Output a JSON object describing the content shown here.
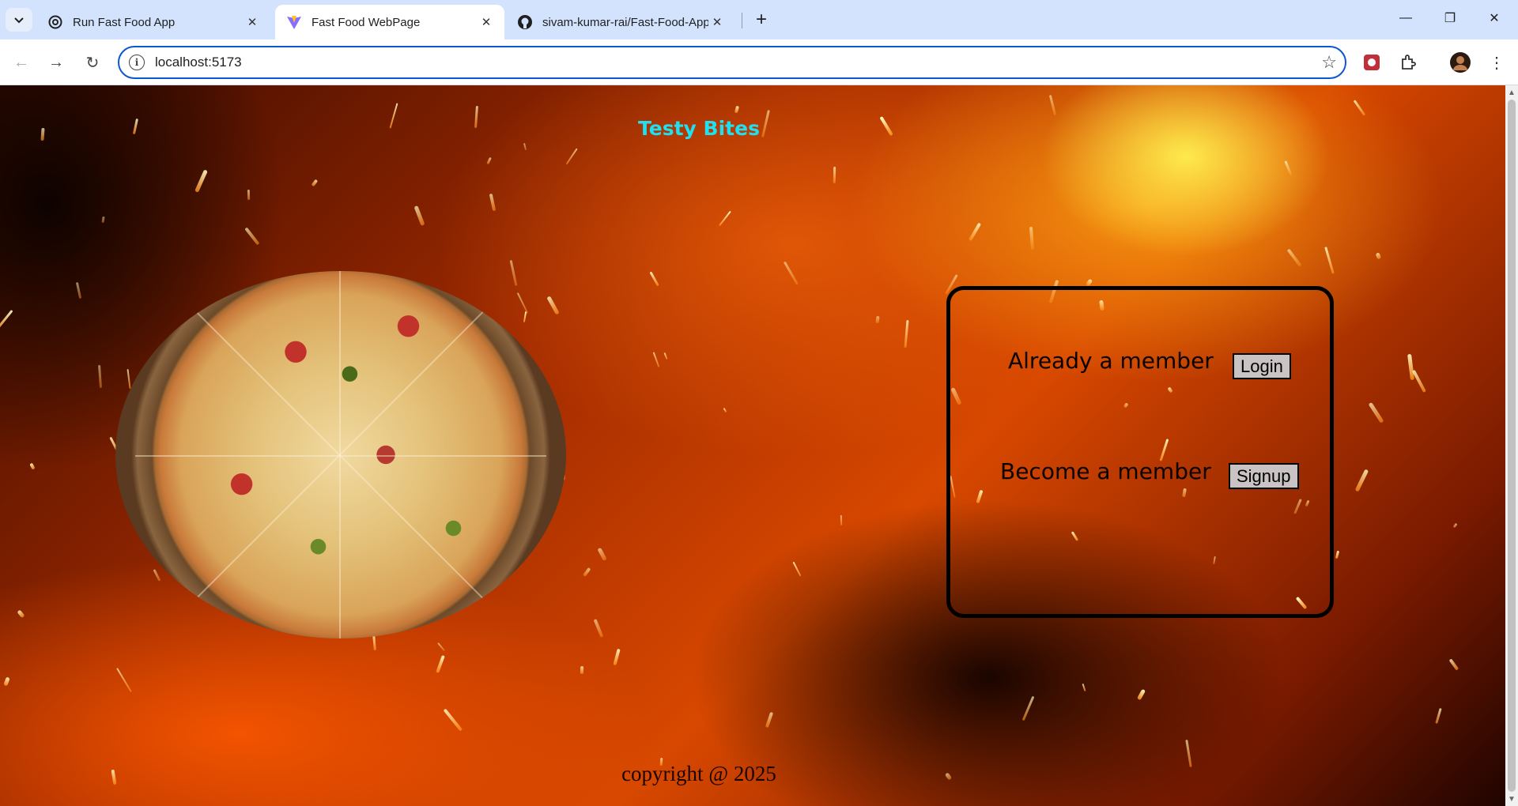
{
  "browser": {
    "tabs": [
      {
        "title": "Run Fast Food App",
        "icon": "openai-icon",
        "active": false
      },
      {
        "title": "Fast Food WebPage",
        "icon": "vite-icon",
        "active": true
      },
      {
        "title": "sivam-kumar-rai/Fast-Food-App",
        "icon": "github-icon",
        "active": false
      }
    ],
    "address": "localhost:5173"
  },
  "page": {
    "title": "Testy Bites",
    "member_panel": {
      "login_text": "Already a member",
      "login_button": "Login",
      "signup_text": "Become a member",
      "signup_button": "Signup"
    },
    "footer": "copyright @ 2025"
  },
  "colors": {
    "title": "#1fe0f0",
    "omnibox_border": "#0b57d0",
    "tabstrip": "#d3e3fd"
  }
}
